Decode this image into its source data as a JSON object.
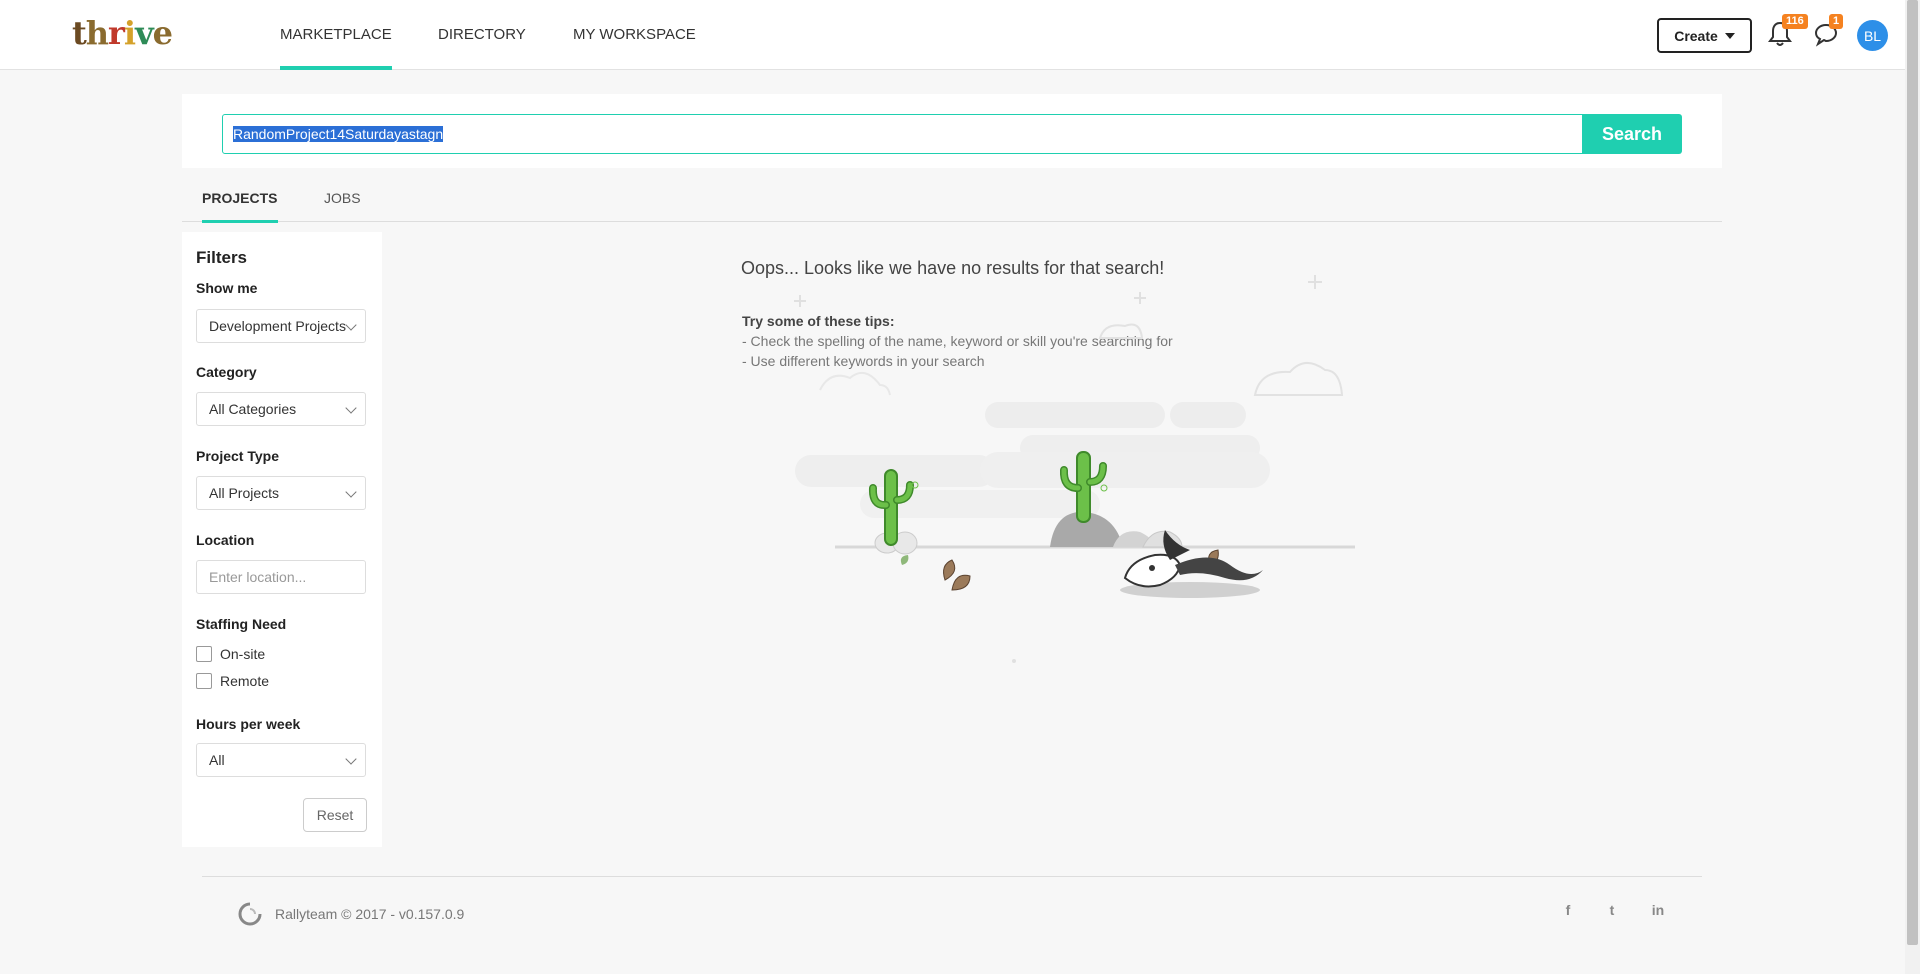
{
  "nav": {
    "logo": [
      "t",
      "h",
      "r",
      "i",
      "v",
      "e"
    ],
    "tabs": [
      "MARKETPLACE",
      "DIRECTORY",
      "MY WORKSPACE"
    ],
    "create_label": "Create",
    "notifications_count": "116",
    "messages_count": "1",
    "avatar_initials": "BL"
  },
  "search": {
    "query": "RandomProject14Saturdayastagn",
    "button_label": "Search"
  },
  "results_tabs": [
    "PROJECTS",
    "JOBS"
  ],
  "filters": {
    "title": "Filters",
    "show_me_label": "Show me",
    "show_me_value": "Development Projects",
    "category_label": "Category",
    "category_value": "All Categories",
    "project_type_label": "Project Type",
    "project_type_value": "All Projects",
    "location_label": "Location",
    "location_placeholder": "Enter location...",
    "staffing_label": "Staffing Need",
    "staffing_options": [
      "On-site",
      "Remote"
    ],
    "hours_label": "Hours per week",
    "hours_value": "All",
    "reset_label": "Reset"
  },
  "no_results": {
    "title": "Oops... Looks like we have no results for that search!",
    "tips_heading": "Try some of these tips:",
    "tips": [
      "- Check the spelling of the name, keyword or skill you're searching for",
      "- Use different keywords in your search"
    ]
  },
  "footer": {
    "text": "Rallyteam © 2017 - v0.157.0.9",
    "social": [
      "f",
      "t",
      "in"
    ]
  },
  "colors": {
    "accent": "#1fcfb0",
    "badge": "#f58220",
    "avatar": "#2d8fe8"
  }
}
